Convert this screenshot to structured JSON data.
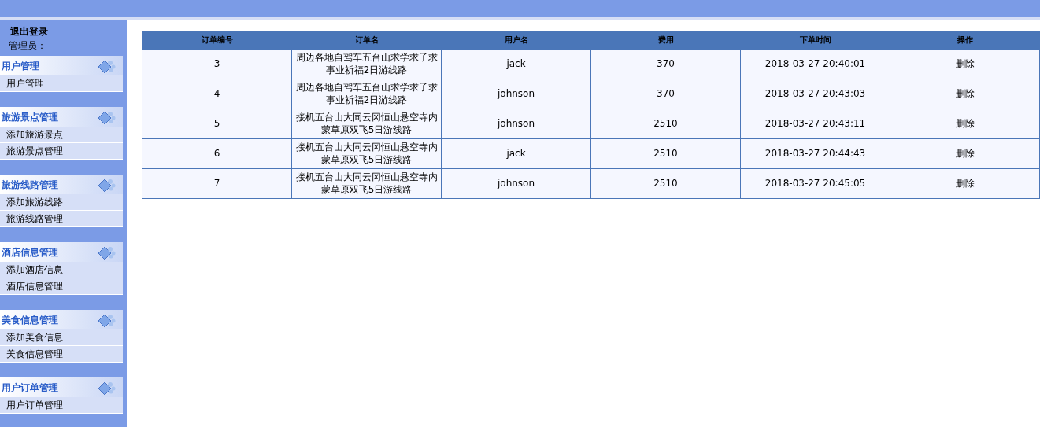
{
  "sidebar": {
    "logout": "退出登录",
    "admin_label": "管理员：",
    "groups": [
      {
        "title": "用户管理",
        "items": [
          "用户管理"
        ]
      },
      {
        "title": "旅游景点管理",
        "items": [
          "添加旅游景点",
          "旅游景点管理"
        ]
      },
      {
        "title": "旅游线路管理",
        "items": [
          "添加旅游线路",
          "旅游线路管理"
        ]
      },
      {
        "title": "酒店信息管理",
        "items": [
          "添加酒店信息",
          "酒店信息管理"
        ]
      },
      {
        "title": "美食信息管理",
        "items": [
          "添加美食信息",
          "美食信息管理"
        ]
      },
      {
        "title": "用户订单管理",
        "items": [
          "用户订单管理"
        ]
      }
    ]
  },
  "table": {
    "columns": [
      "订单编号",
      "订单名",
      "用户名",
      "费用",
      "下单时间",
      "操作"
    ],
    "rows": [
      {
        "id": "3",
        "name": "周边各地自驾车五台山求学求子求事业祈福2日游线路",
        "user": "jack",
        "fee": "370",
        "time": "2018-03-27 20:40:01",
        "action": "删除"
      },
      {
        "id": "4",
        "name": "周边各地自驾车五台山求学求子求事业祈福2日游线路",
        "user": "johnson",
        "fee": "370",
        "time": "2018-03-27 20:43:03",
        "action": "删除"
      },
      {
        "id": "5",
        "name": "接机五台山大同云冈恒山悬空寺内蒙草原双飞5日游线路",
        "user": "johnson",
        "fee": "2510",
        "time": "2018-03-27 20:43:11",
        "action": "删除"
      },
      {
        "id": "6",
        "name": "接机五台山大同云冈恒山悬空寺内蒙草原双飞5日游线路",
        "user": "jack",
        "fee": "2510",
        "time": "2018-03-27 20:44:43",
        "action": "删除"
      },
      {
        "id": "7",
        "name": "接机五台山大同云冈恒山悬空寺内蒙草原双飞5日游线路",
        "user": "johnson",
        "fee": "2510",
        "time": "2018-03-27 20:45:05",
        "action": "删除"
      }
    ]
  }
}
